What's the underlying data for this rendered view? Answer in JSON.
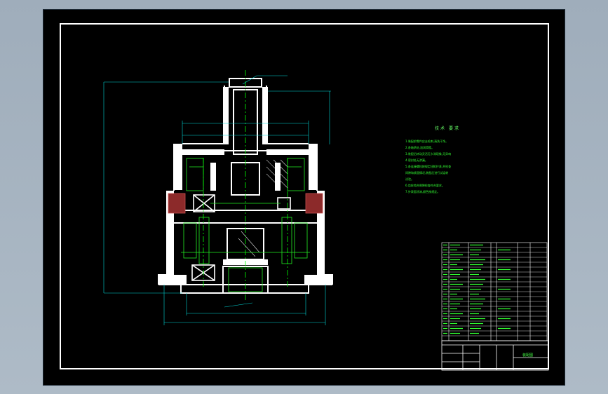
{
  "drawing": {
    "colors": {
      "background": "#000000",
      "frame": "#ffffff",
      "outline": "#ffffff",
      "dimension": "#00d8d8",
      "centerline": "#00ff00",
      "hatch": "#b43c3c",
      "annotation": "#33ff33"
    },
    "tech_notes": {
      "title": "技术 要求",
      "lines": [
        "1.装配前零件应去毛刺,清洗干净。",
        "2.各轴承处,加润滑脂。",
        "3.装配后转动灵活无卡滞现象,无异响",
        "4.密封处无渗漏。",
        "5.各连接螺栓按规定扭矩拧紧,并检查",
        "间隙和紧固情况,装配后进行试运转",
        "试验。",
        "6.齿轮啮合侧隙检查符合要求。",
        "7.外表面涂漆,颜色按规定。"
      ]
    },
    "title_block": {
      "drawing_name": "装配图"
    }
  }
}
